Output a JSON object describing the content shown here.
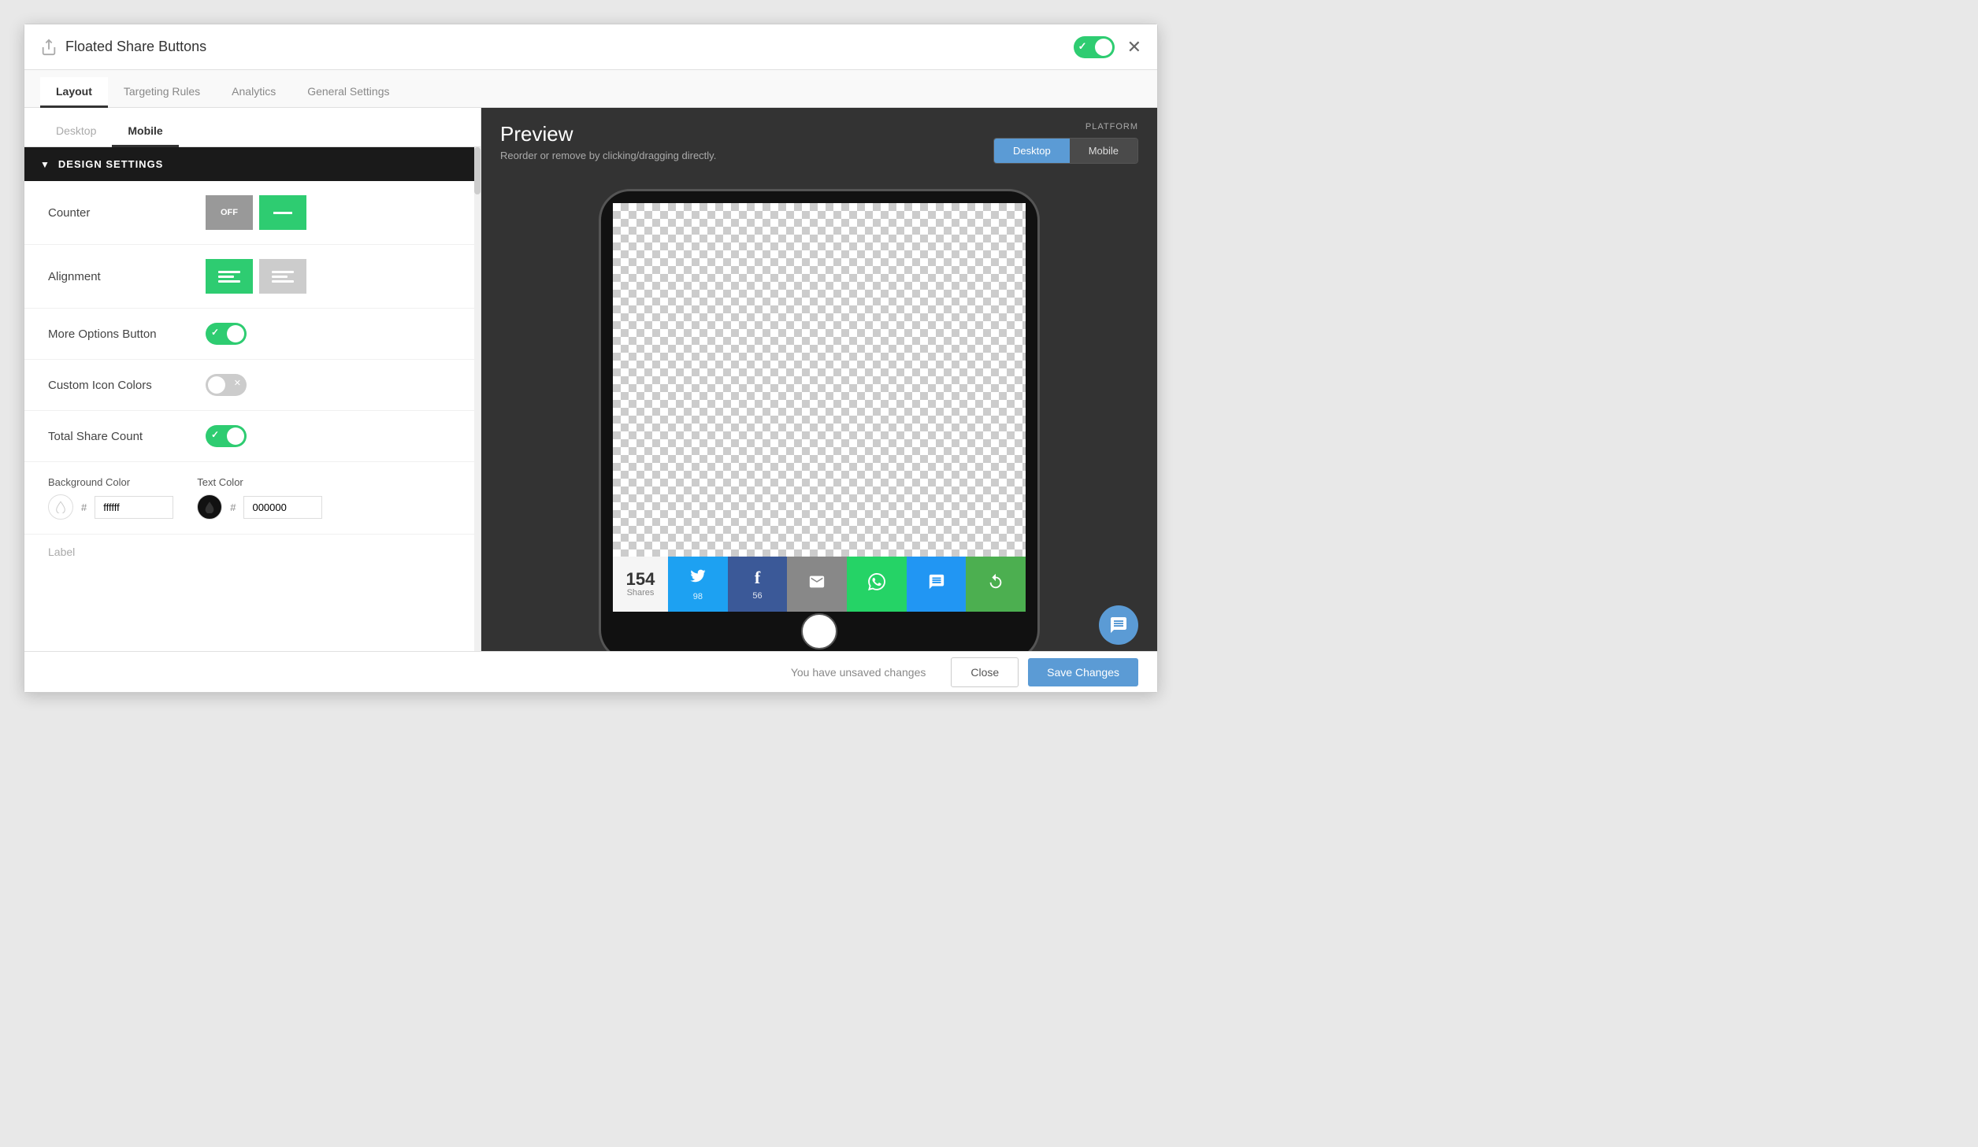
{
  "titleBar": {
    "title": "Floated Share Buttons",
    "closeLabel": "✕"
  },
  "tabs": [
    {
      "id": "layout",
      "label": "Layout",
      "active": true
    },
    {
      "id": "targeting",
      "label": "Targeting Rules",
      "active": false
    },
    {
      "id": "analytics",
      "label": "Analytics",
      "active": false
    },
    {
      "id": "general",
      "label": "General Settings",
      "active": false
    }
  ],
  "subTabs": [
    {
      "id": "desktop",
      "label": "Desktop",
      "active": false
    },
    {
      "id": "mobile",
      "label": "Mobile",
      "active": true
    }
  ],
  "designSettings": {
    "sectionLabel": "DESIGN SETTINGS",
    "counter": {
      "label": "Counter",
      "offLabel": "OFF",
      "onSelected": true
    },
    "alignment": {
      "label": "Alignment"
    },
    "moreOptionsButton": {
      "label": "More Options Button",
      "enabled": true
    },
    "customIconColors": {
      "label": "Custom Icon Colors",
      "enabled": false
    },
    "totalShareCount": {
      "label": "Total Share Count",
      "enabled": true
    },
    "backgroundColor": {
      "label": "Background Color",
      "hashSymbol": "#",
      "value": "ffffff"
    },
    "textColor": {
      "label": "Text Color",
      "hashSymbol": "#",
      "value": "000000"
    }
  },
  "labelRow": {
    "label": "Label"
  },
  "preview": {
    "title": "Preview",
    "subtitle": "Reorder or remove by clicking/dragging directly.",
    "platformLabel": "PLATFORM",
    "desktopBtn": "Desktop",
    "mobileBtn": "Mobile"
  },
  "shareBar": {
    "count": "154",
    "countLabel": "Shares",
    "buttons": [
      {
        "id": "twitter",
        "icon": "🐦",
        "count": "98",
        "class": "twitter-btn"
      },
      {
        "id": "facebook",
        "icon": "f",
        "count": "56",
        "class": "facebook-btn"
      },
      {
        "id": "email",
        "icon": "✉",
        "count": "",
        "class": "email-btn"
      },
      {
        "id": "whatsapp",
        "icon": "📱",
        "count": "",
        "class": "whatsapp-btn"
      },
      {
        "id": "sms",
        "icon": "💬",
        "count": "",
        "class": "sms-btn"
      },
      {
        "id": "more",
        "icon": "↻",
        "count": "",
        "class": "more-btn"
      }
    ]
  },
  "bottomBar": {
    "unsavedText": "You have unsaved changes",
    "closeLabel": "Close",
    "saveLabel": "Save Changes"
  }
}
